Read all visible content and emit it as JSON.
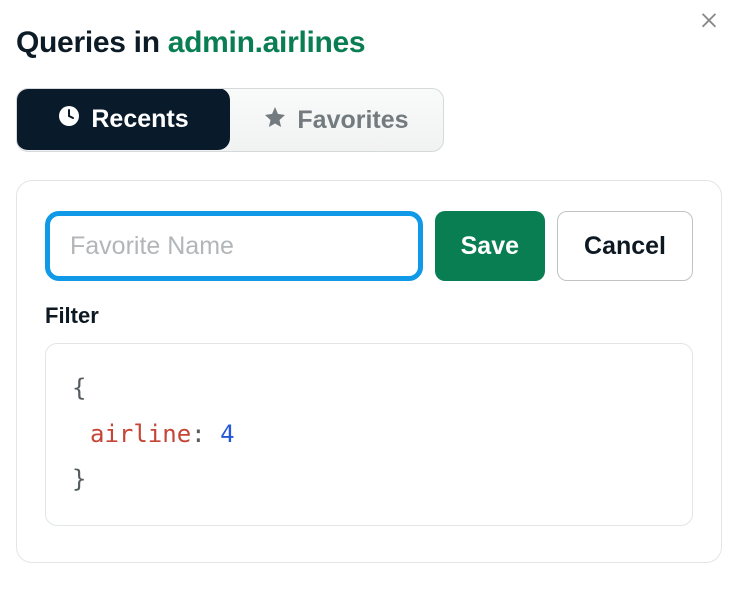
{
  "title": {
    "prefix": "Queries in ",
    "namespace": "admin.airlines"
  },
  "tabs": {
    "recents": "Recents",
    "favorites": "Favorites"
  },
  "form": {
    "name_placeholder": "Favorite Name",
    "save_label": "Save",
    "cancel_label": "Cancel"
  },
  "filter": {
    "label": "Filter",
    "code": {
      "open": "{",
      "key": "airline",
      "sep": ": ",
      "value": "4",
      "close": "}"
    }
  }
}
